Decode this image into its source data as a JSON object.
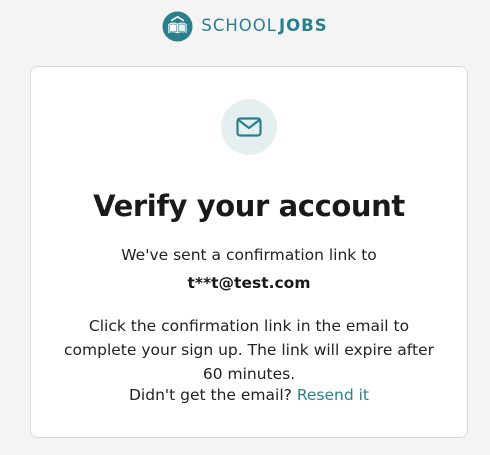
{
  "brand": {
    "name_part1": "SCHOOL",
    "name_part2": "JOBS",
    "accent_color": "#2a7f8d"
  },
  "verify": {
    "icon": "envelope-icon",
    "title": "Verify your account",
    "sent_text": "We've sent a confirmation link to",
    "email": "t**t@test.com",
    "instructions": "Click the confirmation link in the email to complete your sign up. The link will expire after 60 minutes.",
    "resend_prompt": "Didn't get the email?",
    "resend_link": "Resend it"
  }
}
